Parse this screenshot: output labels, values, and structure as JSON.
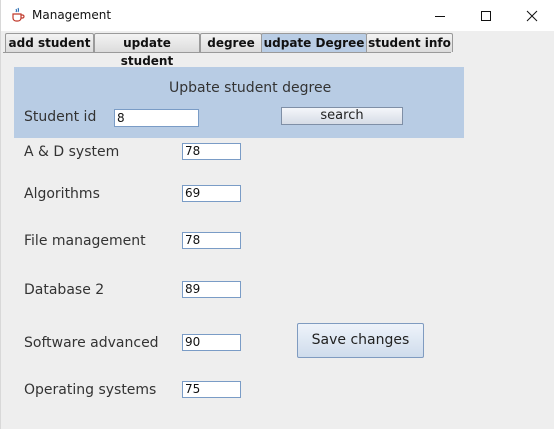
{
  "window": {
    "title": "Management",
    "icon": "java-coffee-cup-icon"
  },
  "tabs": [
    {
      "label": "add student"
    },
    {
      "label": "update student"
    },
    {
      "label": "degree"
    },
    {
      "label": "udpate Degree",
      "active": true
    },
    {
      "label": "student info"
    }
  ],
  "panel": {
    "title": "Upbate student degree",
    "student_id_label": "Student id",
    "student_id_value": "8",
    "search_label": "search"
  },
  "subjects": [
    {
      "name": "A & D system",
      "grade": "78"
    },
    {
      "name": "Algorithms",
      "grade": "69"
    },
    {
      "name": "File management",
      "grade": "78"
    },
    {
      "name": "Database 2",
      "grade": "89"
    },
    {
      "name": "Software advanced",
      "grade": "90"
    },
    {
      "name": "Operating systems",
      "grade": "75"
    }
  ],
  "save_label": "Save changes",
  "colors": {
    "panel_bg": "#b8cce4",
    "active_tab": "#b9cde5",
    "field_border": "#7a9cc6"
  }
}
